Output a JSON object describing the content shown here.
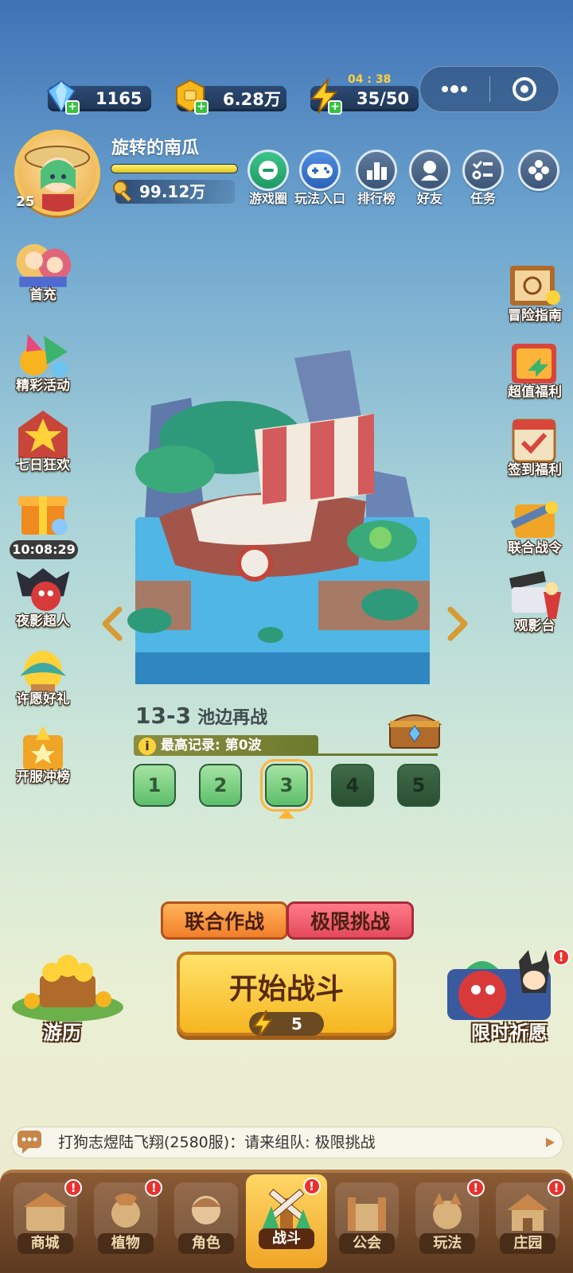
{
  "resources": {
    "gems": "1165",
    "gold": "6.28万",
    "energy": "35/50",
    "energy_timer": "04 : 38"
  },
  "player": {
    "name": "旋转的南瓜",
    "level": "25",
    "power": "99.12万",
    "xp_fraction": 1.0
  },
  "top_buttons": [
    {
      "label": "游戏圈",
      "icon": "game-circle-icon"
    },
    {
      "label": "玩法入口",
      "icon": "gamepad-icon"
    },
    {
      "label": "排行榜",
      "icon": "ranking-icon"
    },
    {
      "label": "好友",
      "icon": "friends-icon"
    },
    {
      "label": "任务",
      "icon": "tasks-icon"
    },
    {
      "label": "",
      "icon": "more-icon"
    }
  ],
  "left_menu": [
    {
      "label": "首充",
      "icon": "first-charge-icon"
    },
    {
      "label": "精彩活动",
      "icon": "events-icon"
    },
    {
      "label": "七日狂欢",
      "icon": "seven-day-icon"
    },
    {
      "label": "",
      "icon": "gift-box-icon"
    },
    {
      "label": "夜影超人",
      "icon": "night-hero-icon"
    },
    {
      "label": "许愿好礼",
      "icon": "wish-gift-icon"
    },
    {
      "label": "开服冲榜",
      "icon": "server-rank-icon"
    }
  ],
  "gift_timer": "10:08:29",
  "right_menu": [
    {
      "label": "冒险指南",
      "icon": "adventure-guide-icon"
    },
    {
      "label": "超值福利",
      "icon": "value-welfare-icon"
    },
    {
      "label": "签到福利",
      "icon": "checkin-icon"
    },
    {
      "label": "联合战令",
      "icon": "battle-pass-icon"
    },
    {
      "label": "观影台",
      "icon": "cinema-icon"
    }
  ],
  "stage": {
    "code": "13-3",
    "name": "池边再战",
    "record": "最高记录: 第0波",
    "waves": [
      "1",
      "2",
      "3",
      "4",
      "5"
    ],
    "selected_wave": "3"
  },
  "modes": {
    "coop": "联合作战",
    "limit": "极限挑战"
  },
  "start": {
    "label": "开始战斗",
    "cost": "5"
  },
  "side_actions": {
    "travel": "游历",
    "limited_wish": "限时祈愿"
  },
  "chat": "打狗志煜陆飞翔(2580服)：请来组队: 极限挑战",
  "nav": [
    {
      "label": "商城",
      "icon": "shop-icon",
      "badge": "!"
    },
    {
      "label": "植物",
      "icon": "plant-icon",
      "badge": "!"
    },
    {
      "label": "角色",
      "icon": "character-icon",
      "badge": ""
    },
    {
      "label": "战斗",
      "icon": "battle-icon",
      "badge": "!"
    },
    {
      "label": "公会",
      "icon": "guild-icon",
      "badge": ""
    },
    {
      "label": "玩法",
      "icon": "gameplay-icon",
      "badge": "!"
    },
    {
      "label": "庄园",
      "icon": "manor-icon",
      "badge": "!"
    }
  ],
  "colors": {
    "accent": "#f6b51f",
    "badge": "#e8322f",
    "nav_bg": "#6e4528"
  }
}
